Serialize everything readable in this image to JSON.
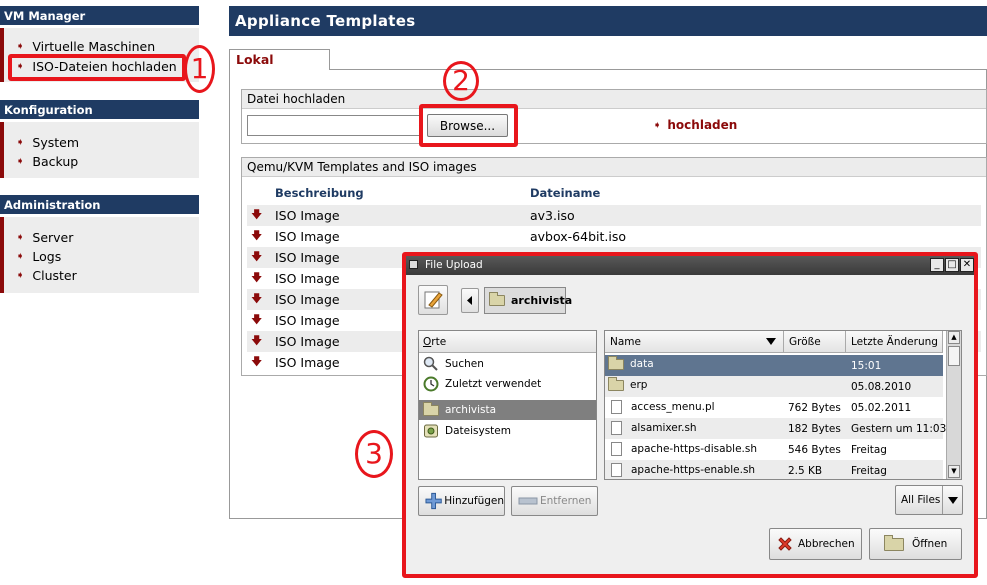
{
  "sidebar": {
    "sections": [
      {
        "title": "VM Manager",
        "items": [
          "Virtuelle Maschinen",
          "ISO-Dateien hochladen"
        ]
      },
      {
        "title": "Konfiguration",
        "items": [
          "System",
          "Backup"
        ]
      },
      {
        "title": "Administration",
        "items": [
          "Server",
          "Logs",
          "Cluster"
        ]
      }
    ]
  },
  "main": {
    "title": "Appliance Templates",
    "tab": "Lokal",
    "upload": {
      "legend": "Datei hochladen",
      "browse_label": "Browse...",
      "upload_link": "hochladen"
    },
    "templates": {
      "legend": "Qemu/KVM Templates and ISO images",
      "columns": [
        "Beschreibung",
        "Dateiname"
      ],
      "rows": [
        {
          "desc": "ISO Image",
          "file": "av3.iso"
        },
        {
          "desc": "ISO Image",
          "file": "avbox-64bit.iso"
        },
        {
          "desc": "ISO Image",
          "file": ""
        },
        {
          "desc": "ISO Image",
          "file": ""
        },
        {
          "desc": "ISO Image",
          "file": ""
        },
        {
          "desc": "ISO Image",
          "file": ""
        },
        {
          "desc": "ISO Image",
          "file": ""
        },
        {
          "desc": "ISO Image",
          "file": ""
        }
      ]
    }
  },
  "annotations": [
    "1",
    "2",
    "3"
  ],
  "dialog": {
    "title": "File Upload",
    "path": "archivista",
    "places_header": "Orte",
    "places": [
      "Suchen",
      "Zuletzt verwendet",
      "archivista",
      "Dateisystem"
    ],
    "file_columns": [
      "Name",
      "Größe",
      "Letzte Änderung"
    ],
    "files": [
      {
        "name": "data",
        "size": "",
        "date": "15:01",
        "type": "folder"
      },
      {
        "name": "erp",
        "size": "",
        "date": "05.08.2010",
        "type": "folder"
      },
      {
        "name": "access_menu.pl",
        "size": "762 Bytes",
        "date": "05.02.2011",
        "type": "file"
      },
      {
        "name": "alsamixer.sh",
        "size": "182 Bytes",
        "date": "Gestern um 11:03",
        "type": "file"
      },
      {
        "name": "apache-https-disable.sh",
        "size": "546 Bytes",
        "date": "Freitag",
        "type": "file"
      },
      {
        "name": "apache-https-enable.sh",
        "size": "2.5 KB",
        "date": "Freitag",
        "type": "file"
      }
    ],
    "add_label": "Hinzufügen",
    "remove_label": "Entfernen",
    "filter": "All Files",
    "cancel_label": "Abbrechen",
    "open_label": "Öffnen"
  },
  "colors": {
    "nav_header": "#1f3b63",
    "accent": "#8b0a0a",
    "annotation": "#e8161c",
    "selection": "#5f7590"
  }
}
